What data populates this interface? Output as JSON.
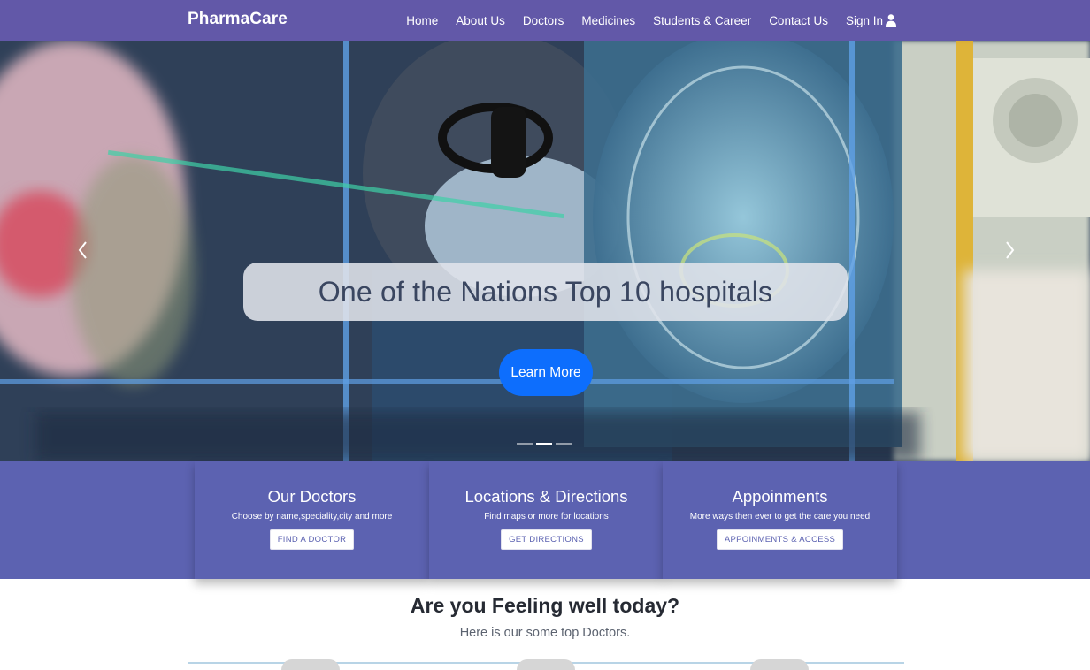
{
  "navbar": {
    "brand": "PharmaCare",
    "links": [
      "Home",
      "About Us",
      "Doctors",
      "Medicines",
      "Students & Career",
      "Contact Us"
    ],
    "signin": "Sign In"
  },
  "hero": {
    "title": "One of the Nations Top 10 hospitals",
    "cta": "Learn More",
    "slides": 3,
    "active_slide": 2
  },
  "cards": [
    {
      "title": "Our Doctors",
      "subtitle": "Choose by name,speciality,city and more",
      "button": "FIND A DOCTOR"
    },
    {
      "title": "Locations & Directions",
      "subtitle": "Find maps or more for locations",
      "button": "GET DIRECTIONS"
    },
    {
      "title": "Appoinments",
      "subtitle": "More ways then ever to get the care you need",
      "button": "APPOINMENTS & ACCESS"
    }
  ],
  "section": {
    "title": "Are you Feeling well today?",
    "subtitle": "Here is our some top Doctors."
  },
  "colors": {
    "navbar": "#6258a8",
    "band": "#5c62b1",
    "cta": "#0d6efd"
  }
}
